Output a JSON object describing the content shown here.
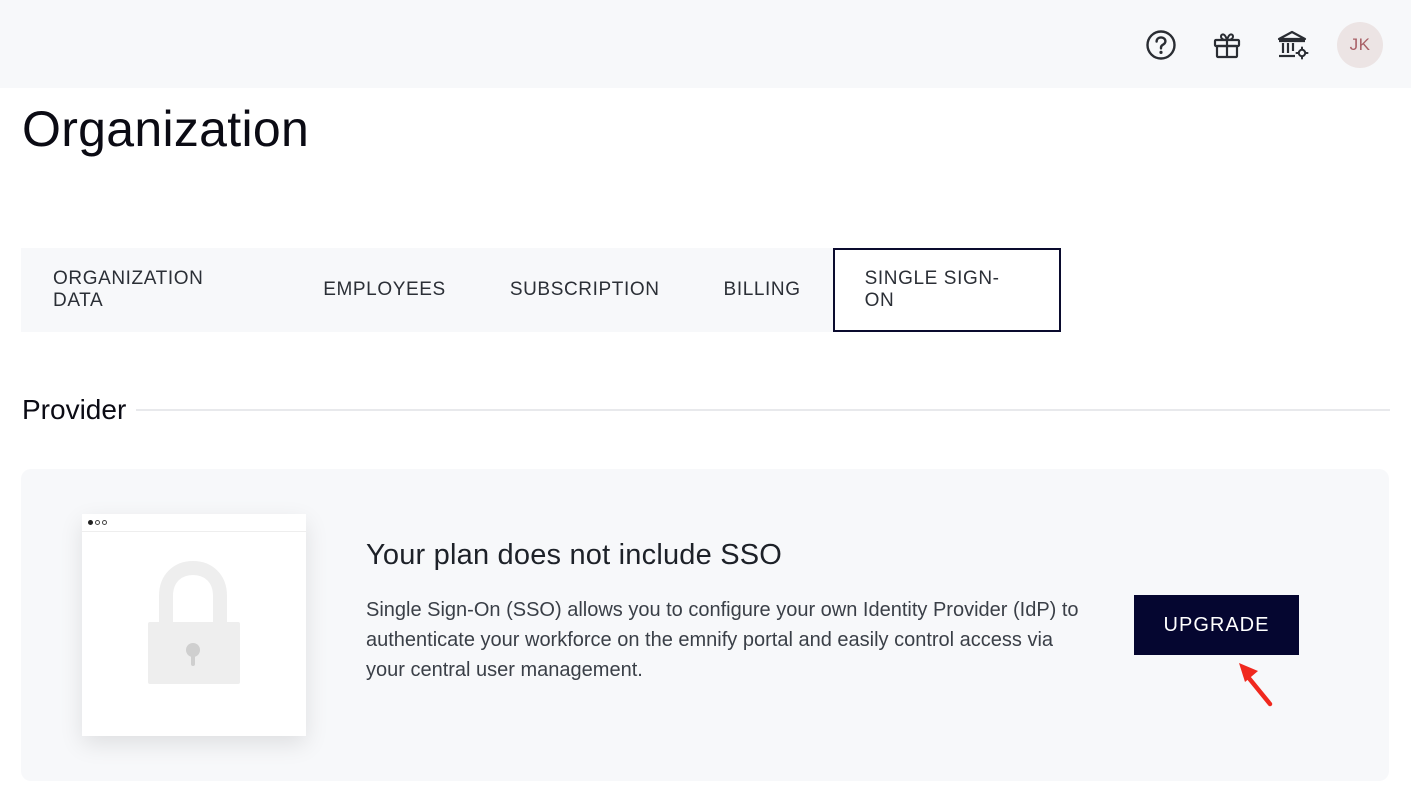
{
  "header": {
    "icons": [
      "help-circle-icon",
      "gift-icon",
      "bank-settings-icon"
    ],
    "avatar_initials": "JK"
  },
  "page": {
    "title": "Organization"
  },
  "tabs": [
    {
      "label": "ORGANIZATION DATA",
      "active": false
    },
    {
      "label": "EMPLOYEES",
      "active": false
    },
    {
      "label": "SUBSCRIPTION",
      "active": false
    },
    {
      "label": "BILLING",
      "active": false
    },
    {
      "label": "SINGLE SIGN-ON",
      "active": true
    }
  ],
  "section": {
    "title": "Provider"
  },
  "card": {
    "illustration_icon": "lock-icon",
    "heading": "Your plan does not include SSO",
    "description": "Single Sign-On (SSO) allows you to configure your own Identity Provider (IdP) to authenticate your workforce on the emnify portal and easily control access via your central user management.",
    "button_label": "UPGRADE"
  },
  "colors": {
    "accent": "#050630",
    "annotation_arrow": "#f0281e",
    "avatar_bg": "#ece4e4",
    "avatar_text": "#a85f66"
  }
}
